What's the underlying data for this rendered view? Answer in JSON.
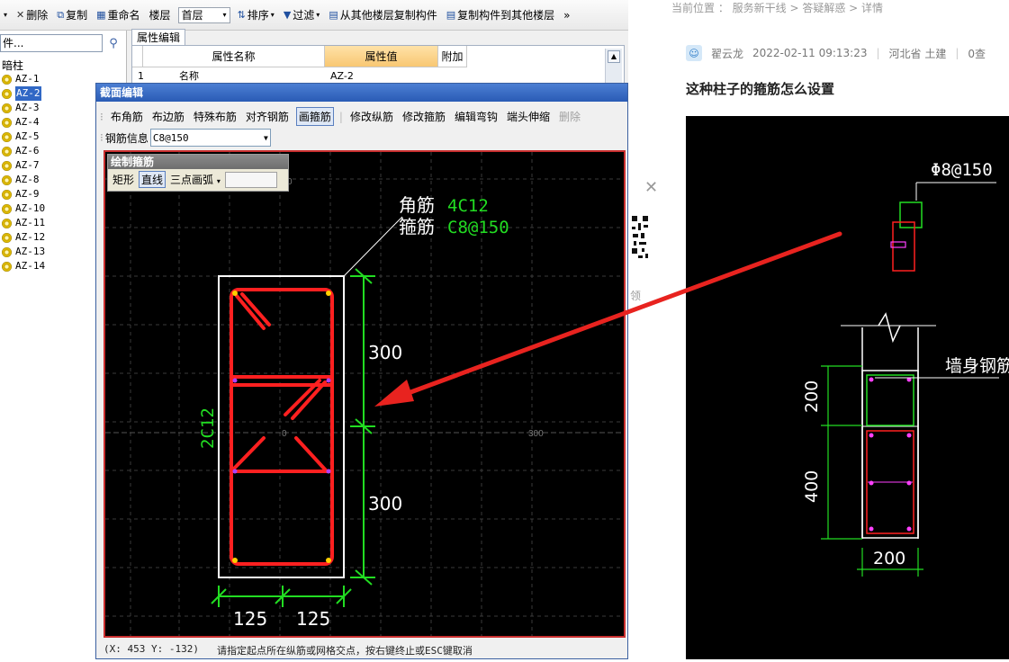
{
  "toolbar": {
    "items": [
      {
        "label": "",
        "icon": "dropdown"
      },
      {
        "label": "删除",
        "icon": "delete-icon"
      },
      {
        "label": "复制",
        "icon": "copy-icon"
      },
      {
        "label": "重命名",
        "icon": "rename-icon"
      },
      {
        "label": "楼层",
        "icon": ""
      },
      {
        "label": "排序",
        "icon": "sort-icon"
      },
      {
        "label": "过滤",
        "icon": "filter-icon"
      },
      {
        "label": "从其他楼层复制构件",
        "icon": "copy-from-floor-icon"
      },
      {
        "label": "复制构件到其他楼层",
        "icon": "copy-to-floor-icon"
      },
      {
        "label": "»",
        "icon": ""
      }
    ],
    "floor_value": "首层"
  },
  "left": {
    "search_placeholder": "件...",
    "root": "暗柱",
    "items": [
      "AZ-1",
      "AZ-2",
      "AZ-3",
      "AZ-4",
      "AZ-5",
      "AZ-6",
      "AZ-7",
      "AZ-8",
      "AZ-9",
      "AZ-10",
      "AZ-11",
      "AZ-12",
      "AZ-13",
      "AZ-14"
    ],
    "selected": "AZ-2"
  },
  "props": {
    "tab": "属性编辑",
    "headers": [
      "属性名称",
      "属性值",
      "附加"
    ],
    "row": {
      "index": "1",
      "name": "名称",
      "value": "AZ-2"
    }
  },
  "dialog": {
    "title": "截面编辑",
    "tools": [
      "布角筋",
      "布边筋",
      "特殊布筋",
      "对齐钢筋",
      "画箍筋",
      "修改纵筋",
      "修改箍筋",
      "编辑弯钩",
      "端头伸缩",
      "删除"
    ],
    "active_tool": "画箍筋",
    "rebar_label": "钢筋信息",
    "rebar_value": "C8@150",
    "float_title": "绘制箍筋",
    "float_tools": [
      "矩形",
      "直线",
      "三点画弧"
    ],
    "float_active": "直线",
    "status_coords": "(X: 453 Y: -132)",
    "status_hint": "请指定起点所在纵筋或网格交点，按右键终止或ESC键取消"
  },
  "canvas": {
    "corner_label": "角筋",
    "corner_value": "4C12",
    "stirrup_label": "箍筋",
    "stirrup_value": "C8@150",
    "side_label": "2C12",
    "dim_300_top": "300",
    "dim_300_bottom": "300",
    "dim_125_left": "125",
    "dim_125_right": "125",
    "axis_0": "0",
    "axis_300": "300",
    "axis_0_top": "0"
  },
  "right": {
    "breadcrumb": "当前位置 ： 服务新干线 > 答疑解惑 > 详情",
    "author": "翟云龙",
    "datetime": "2022-02-11 09:13:23",
    "region": "河北省  土建",
    "views": "0查",
    "title": "这种柱子的箍筋怎么设置",
    "sidebar_text": "领",
    "image": {
      "rebar_label": "Φ8@150",
      "wall_label": "墙身钢筋",
      "dim_200_top": "200",
      "dim_400": "400",
      "dim_200_bottom": "200"
    }
  },
  "colors": {
    "accent": "#3168c5",
    "rebar_red": "#ff2020",
    "dim_green": "#22dd22"
  }
}
